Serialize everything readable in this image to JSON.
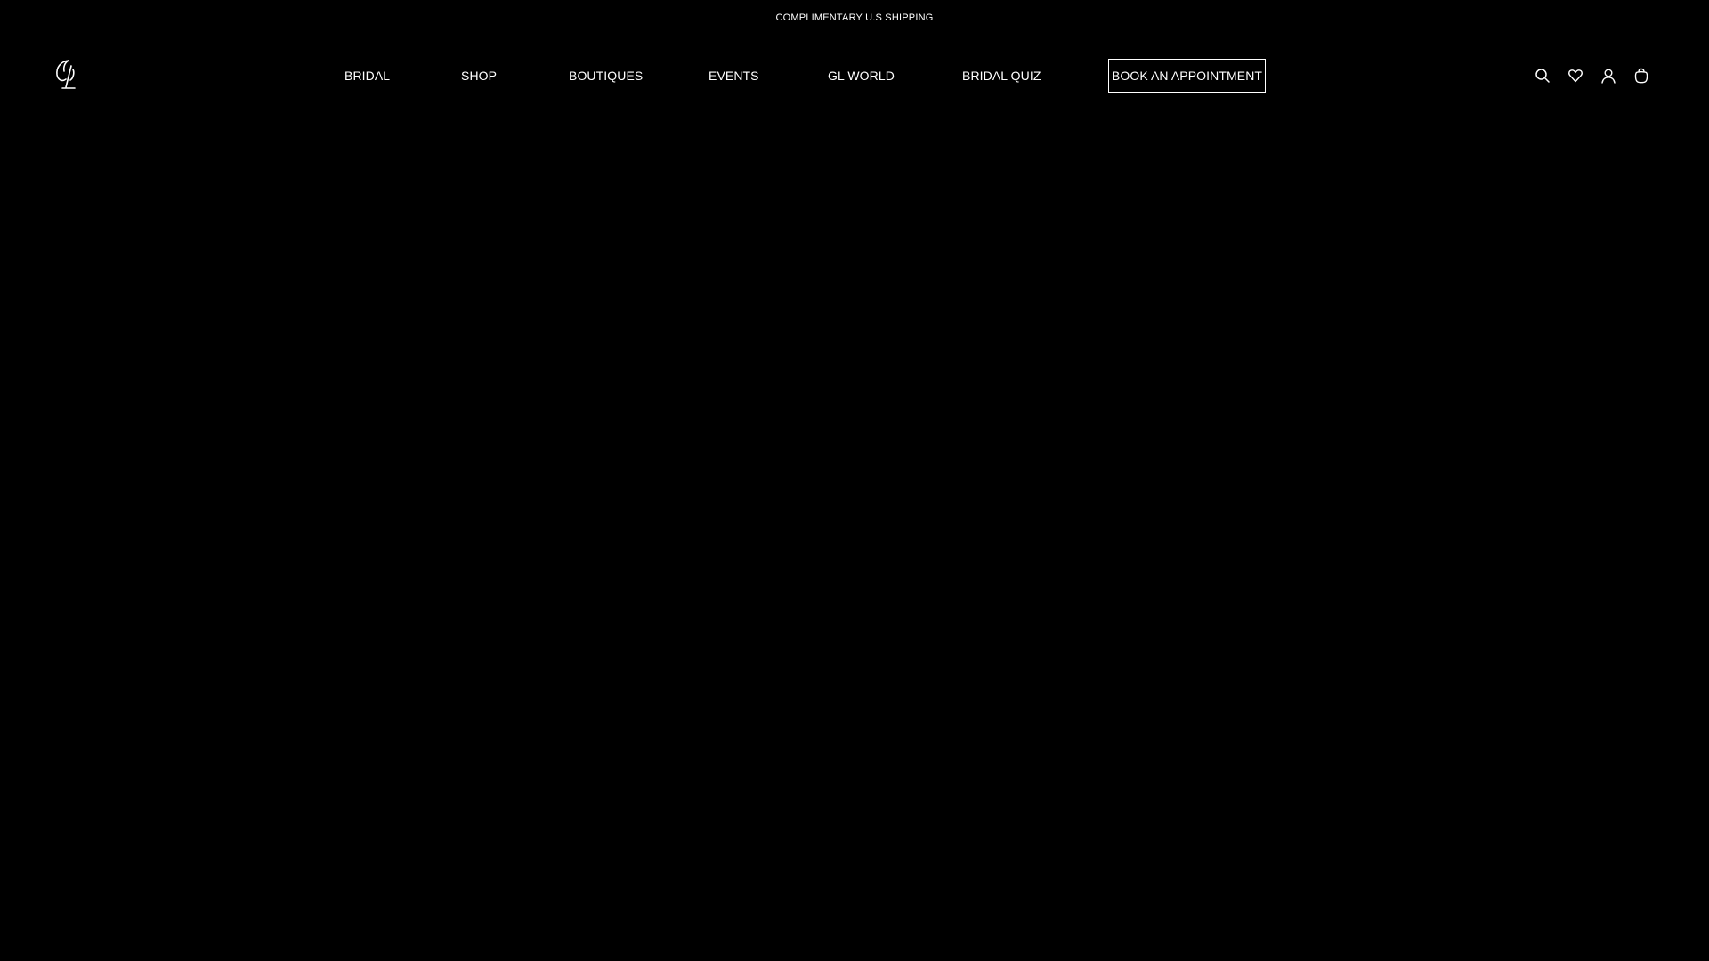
{
  "announcement": {
    "text": "COMPLIMENTARY U.S SHIPPING"
  },
  "header": {
    "logo_icon": "gl-monogram-logo",
    "nav": {
      "bridal": "BRIDAL",
      "shop": "SHOP",
      "boutiques": "BOUTIQUES",
      "events": "EVENTS",
      "gl_world": "GL WORLD",
      "bridal_quiz": "BRIDAL QUIZ"
    },
    "appointment_label": "BOOK AN APPOINTMENT",
    "icons": [
      "search-icon",
      "wishlist-heart-icon",
      "account-icon",
      "shopping-bag-icon"
    ]
  },
  "colors": {
    "background": "#000000",
    "foreground": "#ffffff"
  }
}
